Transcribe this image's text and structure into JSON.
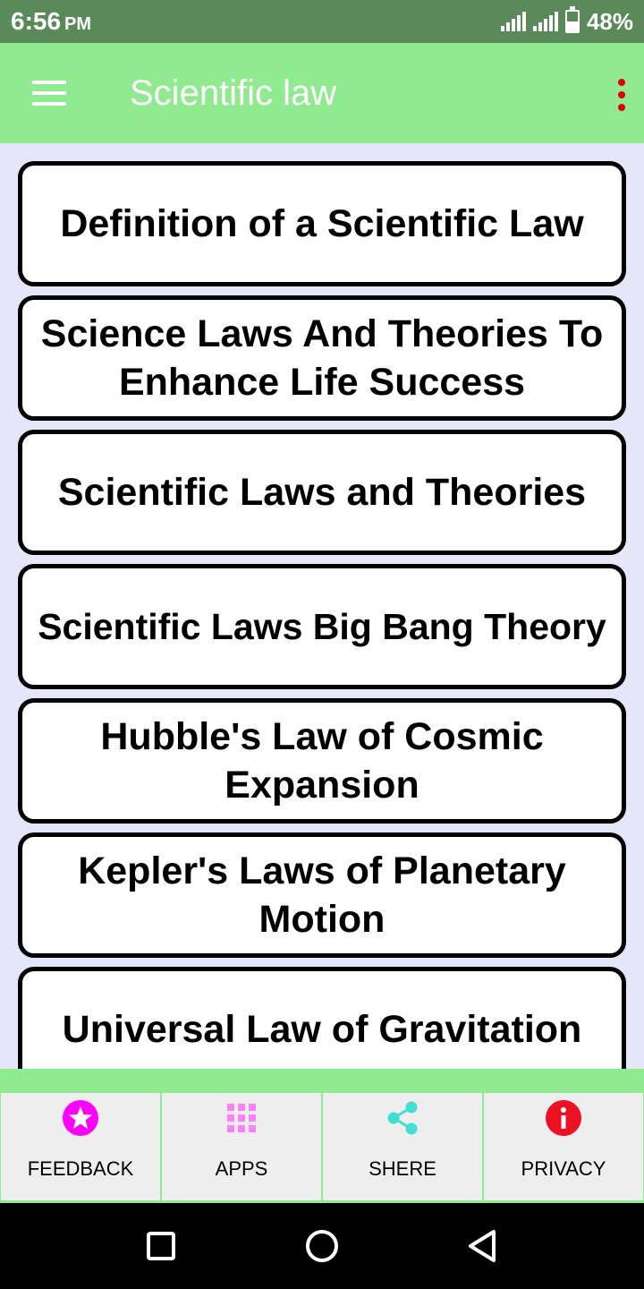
{
  "status": {
    "time": "6:56",
    "ampm": "PM",
    "battery_pct": "48%",
    "battery_level": 0.48
  },
  "appbar": {
    "title": "Scientific law",
    "menu_icon": "hamburger-menu-icon",
    "more_icon": "more-vertical-icon"
  },
  "topics": [
    "Definition of a Scientific Law",
    "Science Laws And Theories To Enhance Life Success",
    "Scientific Laws and Theories",
    "Scientific Laws Big Bang Theory",
    "Hubble's Law of Cosmic Expansion",
    "Kepler's Laws of Planetary Motion",
    "Universal Law of Gravitation"
  ],
  "bottom_nav": [
    {
      "label": "FEEDBACK",
      "icon": "star-icon",
      "color": "#ff00ff"
    },
    {
      "label": "APPS",
      "icon": "apps-grid-icon",
      "color": "#ff80ff"
    },
    {
      "label": "SHERE",
      "icon": "share-icon",
      "color": "#40e0d0"
    },
    {
      "label": "PRIVACY",
      "icon": "info-icon",
      "color": "#ee1122"
    }
  ],
  "colors": {
    "appbar": "#90ea90",
    "content_bg": "#e6e6fa",
    "status_bar": "#5a8a5a"
  },
  "system_nav": [
    "recents-square-icon",
    "home-circle-icon",
    "back-triangle-icon"
  ]
}
